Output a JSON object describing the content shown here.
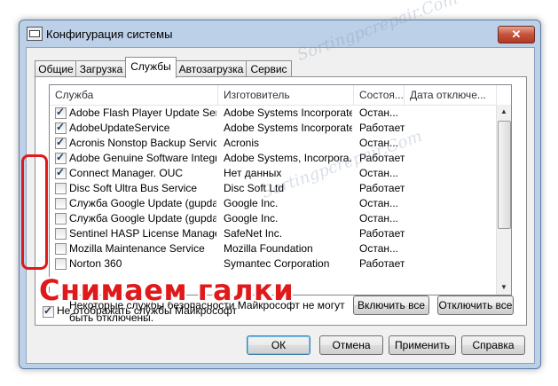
{
  "window": {
    "title": "Конфигурация системы",
    "close_label": "✕"
  },
  "tabs": [
    {
      "label": "Общие"
    },
    {
      "label": "Загрузка"
    },
    {
      "label": "Службы"
    },
    {
      "label": "Автозагрузка"
    },
    {
      "label": "Сервис"
    }
  ],
  "active_tab": "Службы",
  "columns": [
    "Служба",
    "Изготовитель",
    "Состоя...",
    "Дата отключе..."
  ],
  "services": [
    {
      "name": "Adobe Flash Player Update Service",
      "maker": "Adobe Systems Incorporated",
      "status": "Остан...",
      "checked": true
    },
    {
      "name": "AdobeUpdateService",
      "maker": "Adobe Systems Incorporated",
      "status": "Работает",
      "checked": true
    },
    {
      "name": "Acronis Nonstop Backup Service",
      "maker": "Acronis",
      "status": "Остан...",
      "checked": true
    },
    {
      "name": "Adobe Genuine Software Integri...",
      "maker": "Adobe Systems, Incorpora...",
      "status": "Работает",
      "checked": true
    },
    {
      "name": "Connect Manager. OUC",
      "maker": "Нет данных",
      "status": "Остан...",
      "checked": true
    },
    {
      "name": "Disc Soft Ultra Bus Service",
      "maker": "Disc Soft Ltd",
      "status": "Работает",
      "checked": false
    },
    {
      "name": "Служба Google Update (gupdate)",
      "maker": "Google Inc.",
      "status": "Остан...",
      "checked": false
    },
    {
      "name": "Служба Google Update (gupdatem)",
      "maker": "Google Inc.",
      "status": "Остан...",
      "checked": false
    },
    {
      "name": "Sentinel HASP License Manager",
      "maker": "SafeNet Inc.",
      "status": "Работает",
      "checked": false
    },
    {
      "name": "Mozilla Maintenance Service",
      "maker": "Mozilla Foundation",
      "status": "Остан...",
      "checked": false
    },
    {
      "name": "Norton 360",
      "maker": "Symantec Corporation",
      "status": "Работает",
      "checked": false
    }
  ],
  "note": "Некоторые службы безопасности Майкрософт не могут быть отключены.",
  "buttons": {
    "enable_all": "Включить все",
    "disable_all": "Отключить все",
    "ok": "ОК",
    "cancel": "Отмена",
    "apply": "Применить",
    "help": "Справка"
  },
  "hide_ms": {
    "label": "Не отображать службы Майкрософт",
    "checked": true
  },
  "overlay_text": "Снимаем галки",
  "watermark": "Sortingpcrepair.Com",
  "colors": {
    "annotation": "#e0191b",
    "title_bar": "#bcd0e8",
    "close_button": "#c4523c"
  }
}
